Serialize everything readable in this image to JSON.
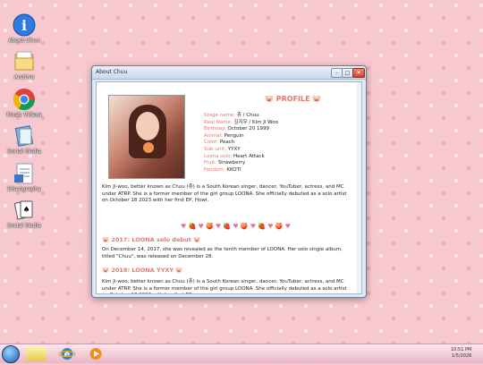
{
  "desktop": {
    "icons": [
      {
        "label": "About Chuu",
        "icon": "info-icon"
      },
      {
        "label": "Archive",
        "icon": "folder-icon"
      },
      {
        "label": "Music Videos",
        "icon": "chrome-icon"
      },
      {
        "label": "Social Media",
        "icon": "notebook-icon"
      },
      {
        "label": "Discography",
        "icon": "document-icon"
      },
      {
        "label": "Social Media",
        "icon": "cards-icon"
      }
    ]
  },
  "window": {
    "title": "About Chuu",
    "profile_heading": "PROFILE",
    "profile": [
      {
        "key": "Stage name:",
        "value": "츄 / Chuu"
      },
      {
        "key": "Real Name:",
        "value": "김지우 / Kim Ji Woo"
      },
      {
        "key": "Birthday:",
        "value": "October 20 1999"
      },
      {
        "key": "Animal:",
        "value": "Penguin"
      },
      {
        "key": "Color:",
        "value": "Peach"
      },
      {
        "key": "Sub-unit:",
        "value": "YYXY"
      },
      {
        "key": "Loona solo:",
        "value": "Heart Attack"
      },
      {
        "key": "Fruit:",
        "value": "Strawberry"
      },
      {
        "key": "Fandom:",
        "value": "KKOTI"
      }
    ],
    "intro": "Kim Ji-woo, better known as Chuu (츄) is a South Korean singer, dancer, YouTuber, actress, and MC under ATRP. She is a former member of the girl group LOONA. She officially debuted as a solo artist on October 18 2023 with her first EP, Howl.",
    "divider": "♥ 🍓 ♥ 🍑 ♥ 🍓 ♥ 🍑 ♥ 🍓 ♥ 🍑 ♥",
    "section1_title": "2017: LOONA solo debut",
    "section1_text": "On December 14, 2017, she was revealed as the tenth member of LOONA. Her solo single album, titled \"Chuu\", was released on December 28.",
    "section2_title": "2018: LOONA YYXY",
    "section2_text": "Kim Ji-woo, better known as Chuu (츄) is a South Korean singer, dancer, YouTuber, actress, and MC under ATRP. She is a former member of the girl group LOONA. She officially debuted as a solo artist on October 18 2023 with her first EP"
  },
  "taskbar": {
    "items": [
      "windows-start-icon",
      "sticky-notes-icon",
      "internet-explorer-icon",
      "media-player-icon"
    ],
    "time": "10:51 PM",
    "date": "1/5/2026"
  }
}
